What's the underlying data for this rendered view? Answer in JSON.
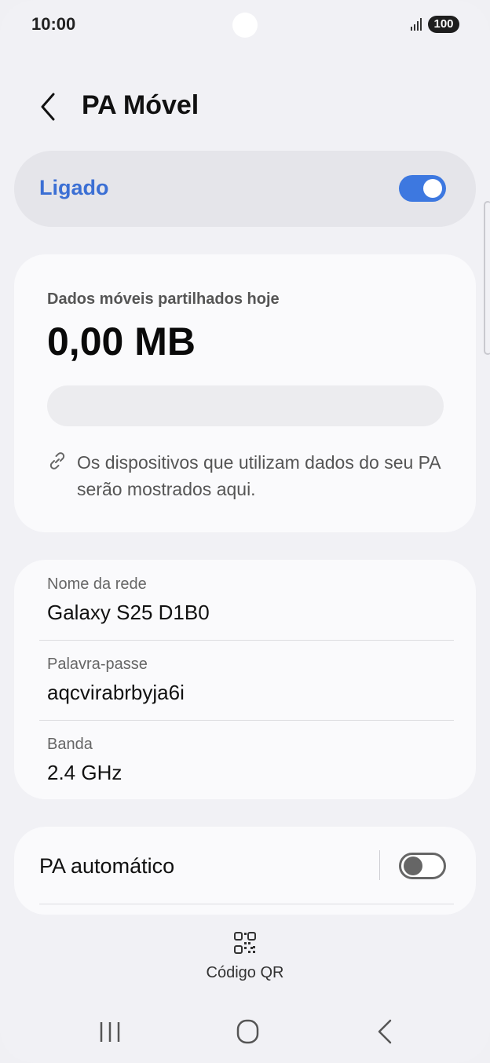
{
  "status_bar": {
    "time": "10:00",
    "battery": "100",
    "icons": [
      "signal-icon",
      "battery-icon"
    ]
  },
  "header": {
    "title": "PA Móvel",
    "back_icon": "back-arrow-icon"
  },
  "master_switch": {
    "label": "Ligado",
    "state": "on",
    "accent_color": "#3d78e0"
  },
  "data_usage": {
    "caption": "Dados móveis partilhados hoje",
    "value": "0,00 MB",
    "used_fraction": 0,
    "info": "Os dispositivos que utilizam dados do seu PA serão mostrados aqui.",
    "info_icon": "link-icon"
  },
  "network": {
    "rows": [
      {
        "label": "Nome da rede",
        "value": "Galaxy S25 D1B0"
      },
      {
        "label": "Palavra-passe",
        "value": "aqcvirabrbyja6i"
      },
      {
        "label": "Banda",
        "value": "2.4 GHz"
      }
    ]
  },
  "auto_hotspot": {
    "label": "PA automático",
    "state": "off"
  },
  "qr": {
    "label": "Código QR",
    "icon": "qr-code-icon"
  },
  "nav": {
    "icons": [
      "recent-apps-icon",
      "home-icon",
      "back-icon"
    ]
  }
}
